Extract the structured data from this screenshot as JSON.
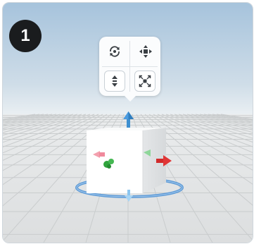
{
  "step_badge": "1",
  "toolbar": {
    "buttons": [
      {
        "name": "rotate-tool-button",
        "icon": "rotate-icon"
      },
      {
        "name": "move-tool-button",
        "icon": "move-arrows-icon"
      },
      {
        "name": "scale-vertical-button",
        "icon": "vertical-resize-icon"
      },
      {
        "name": "uniform-scale-button",
        "icon": "fit-expand-icon"
      }
    ]
  },
  "colors": {
    "sky": "#a9c6de",
    "floor": "#e2e4e5",
    "cube": "#ffffff",
    "gizmo_ring": "#5d9ad6",
    "axis_up": "#3d8fd0",
    "axis_x": "#d12b2b",
    "axis_z": "#2fa43c",
    "axis_neg_x": "#f08a9c"
  }
}
